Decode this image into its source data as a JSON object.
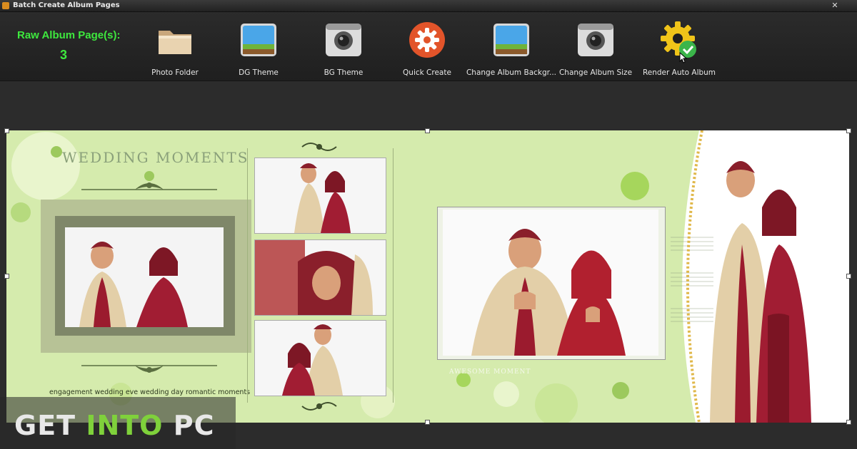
{
  "window": {
    "title": "Batch Create Album Pages",
    "close": "✕"
  },
  "toolbar": {
    "raw_label": "Raw Album Page(s):",
    "raw_count": "3",
    "tools": [
      {
        "label": "Photo Folder",
        "icon": "folder-icon"
      },
      {
        "label": "DG Theme",
        "icon": "landscape-icon"
      },
      {
        "label": "BG Theme",
        "icon": "camera-icon"
      },
      {
        "label": "Quick Create",
        "icon": "gear-icon"
      },
      {
        "label": "Change Album Backgr...",
        "icon": "landscape-icon"
      },
      {
        "label": "Change Album Size",
        "icon": "camera-icon"
      },
      {
        "label": "Render Auto  Album",
        "icon": "gear-check-icon"
      }
    ]
  },
  "album": {
    "title": "WEDDING MOMENTS",
    "caption": "engagement wedding eve wedding day romantic moments",
    "right_caption": "AWESOME MOMENT"
  },
  "watermark": {
    "part1": "GET ",
    "part2": "INTO",
    "part3": " PC"
  },
  "colors": {
    "accent_green": "#3ee83e",
    "album_bg": "#d5ebad",
    "watermark_green": "#7fd13b"
  }
}
